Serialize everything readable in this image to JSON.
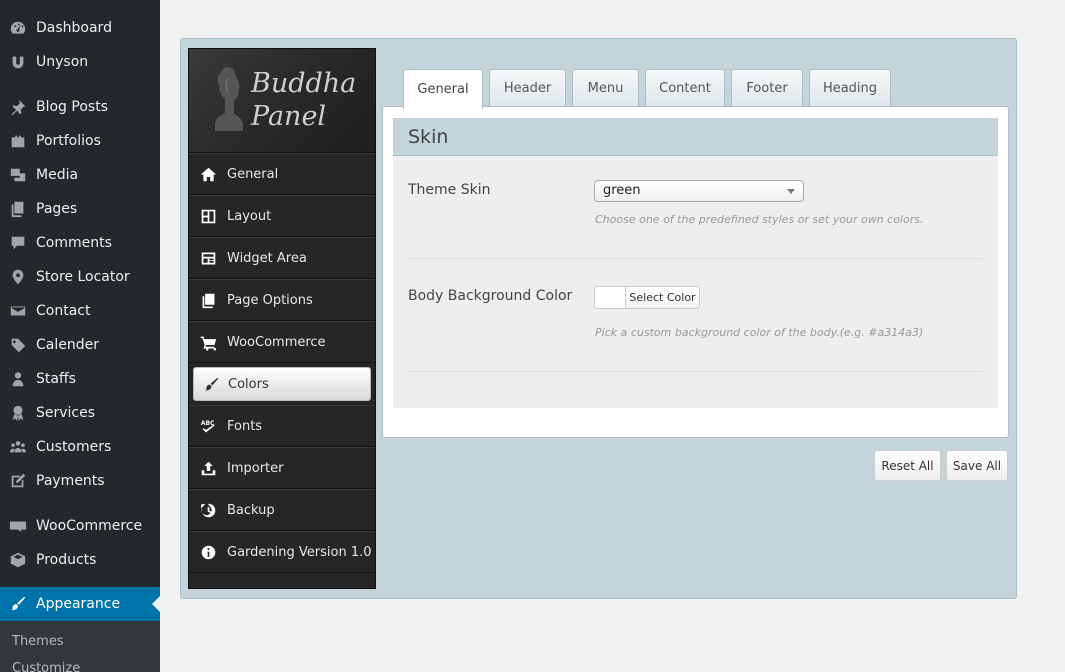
{
  "wp_menu": {
    "items": [
      {
        "label": "Dashboard",
        "icon": "dashboard-icon"
      },
      {
        "label": "Unyson",
        "icon": "unyson-icon"
      },
      {
        "label": "Blog Posts",
        "icon": "pin-icon"
      },
      {
        "label": "Portfolios",
        "icon": "portfolio-icon"
      },
      {
        "label": "Media",
        "icon": "media-icon"
      },
      {
        "label": "Pages",
        "icon": "pages-icon"
      },
      {
        "label": "Comments",
        "icon": "comments-icon"
      },
      {
        "label": "Store Locator",
        "icon": "location-icon"
      },
      {
        "label": "Contact",
        "icon": "mail-icon"
      },
      {
        "label": "Calender",
        "icon": "tag-icon"
      },
      {
        "label": "Staffs",
        "icon": "user-icon"
      },
      {
        "label": "Services",
        "icon": "award-icon"
      },
      {
        "label": "Customers",
        "icon": "users-icon"
      },
      {
        "label": "Payments",
        "icon": "edit-icon"
      },
      {
        "label": "WooCommerce",
        "icon": "woo-icon"
      },
      {
        "label": "Products",
        "icon": "box-icon"
      },
      {
        "label": "Appearance",
        "icon": "brush-icon"
      }
    ],
    "submenu": [
      "Themes",
      "Customize"
    ]
  },
  "panel": {
    "logo_line1": "Buddha",
    "logo_line2": "Panel",
    "nav": [
      {
        "label": "General",
        "icon": "home-icon"
      },
      {
        "label": "Layout",
        "icon": "layout-icon"
      },
      {
        "label": "Widget Area",
        "icon": "widget-icon"
      },
      {
        "label": "Page Options",
        "icon": "copy-icon"
      },
      {
        "label": "WooCommerce",
        "icon": "cart-icon"
      },
      {
        "label": "Colors",
        "icon": "brush-icon"
      },
      {
        "label": "Fonts",
        "icon": "fonts-icon"
      },
      {
        "label": "Importer",
        "icon": "upload-icon"
      },
      {
        "label": "Backup",
        "icon": "history-icon"
      },
      {
        "label": "Gardening Version 1.0",
        "icon": "info-icon"
      }
    ],
    "active_nav": "Colors"
  },
  "tabs": [
    "General",
    "Header",
    "Menu",
    "Content",
    "Footer",
    "Heading"
  ],
  "active_tab": "General",
  "section": {
    "title": "Skin",
    "theme_skin_label": "Theme Skin",
    "theme_skin_value": "green",
    "theme_skin_hint": "Choose one of the predefined styles or set your own colors.",
    "body_bg_label": "Body Background Color",
    "body_bg_button": "Select Color",
    "body_bg_hint": "Pick a custom background color of the body.(e.g. #a314a3)"
  },
  "actions": {
    "reset": "Reset All",
    "save": "Save All"
  },
  "colors": {
    "wp_sidebar": "#23282d",
    "wp_active": "#0073aa",
    "panel_bg": "#c3d4da"
  }
}
